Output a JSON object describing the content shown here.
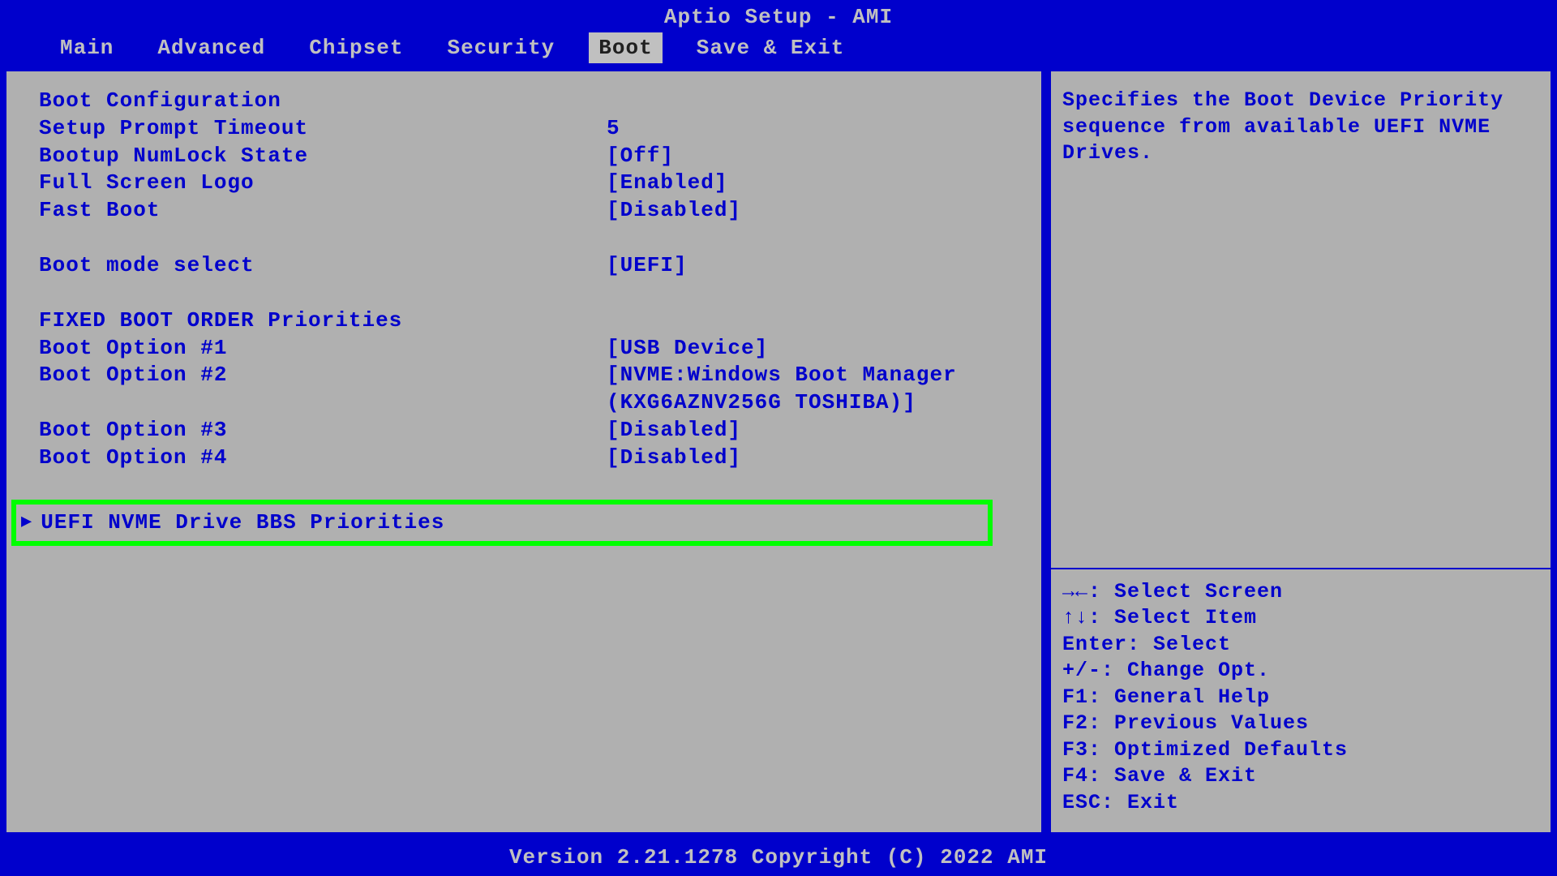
{
  "title": "Aptio Setup - AMI",
  "menu": {
    "items": [
      "Main",
      "Advanced",
      "Chipset",
      "Security",
      "Boot",
      "Save & Exit"
    ],
    "active_index": 4
  },
  "settings": {
    "section1_header": "Boot Configuration",
    "setup_prompt_timeout": {
      "label": "Setup Prompt Timeout",
      "value": "5"
    },
    "bootup_numlock": {
      "label": "Bootup NumLock State",
      "value": "[Off]"
    },
    "full_screen_logo": {
      "label": "Full Screen Logo",
      "value": "[Enabled]"
    },
    "fast_boot": {
      "label": "Fast Boot",
      "value": "[Disabled]"
    },
    "boot_mode_select": {
      "label": "Boot mode select",
      "value": "[UEFI]"
    },
    "section2_header": "FIXED BOOT ORDER Priorities",
    "boot_option_1": {
      "label": "Boot Option #1",
      "value": "[USB Device]"
    },
    "boot_option_2": {
      "label": "Boot Option #2",
      "value": "[NVME:Windows Boot Manager (KXG6AZNV256G TOSHIBA)]"
    },
    "boot_option_3": {
      "label": "Boot Option #3",
      "value": "[Disabled]"
    },
    "boot_option_4": {
      "label": "Boot Option #4",
      "value": "[Disabled]"
    },
    "selected_item": {
      "label": "UEFI NVME Drive BBS Priorities"
    }
  },
  "help": {
    "text": "Specifies the Boot Device Priority sequence from available UEFI NVME Drives."
  },
  "keys": {
    "select_screen": "→←: Select Screen",
    "select_item": "↑↓: Select Item",
    "enter": "Enter: Select",
    "change_opt": "+/-: Change Opt.",
    "f1": "F1: General Help",
    "f2": "F2: Previous Values",
    "f3": "F3: Optimized Defaults",
    "f4": "F4: Save & Exit",
    "esc": "ESC: Exit"
  },
  "footer": "Version 2.21.1278 Copyright (C) 2022 AMI"
}
